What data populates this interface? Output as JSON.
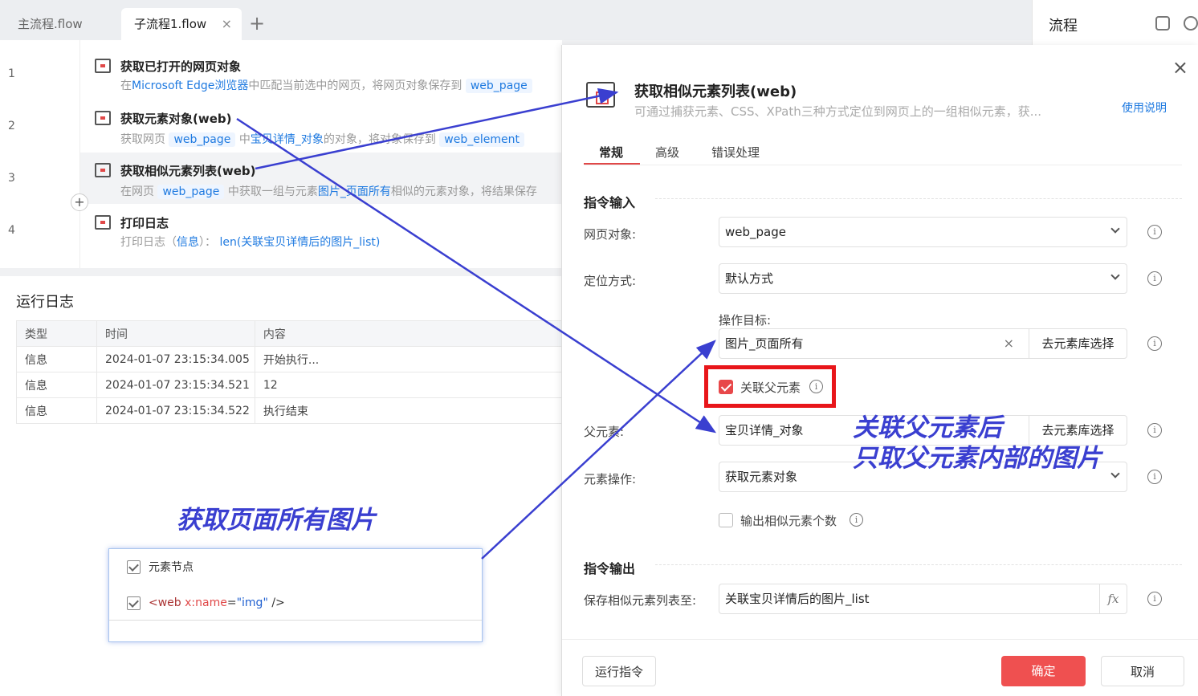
{
  "tabs": {
    "main": "主流程.flow",
    "sub": "子流程1.flow",
    "close": "×",
    "add": "+"
  },
  "flow_panel": {
    "title": "流程"
  },
  "steps": [
    {
      "num": "1",
      "title": "获取已打开的网页对象",
      "desc_a": "在",
      "desc_b": "Microsoft Edge浏览器",
      "desc_c": "中匹配当前选中的网页，将网页对象保存到",
      "desc_tag": "web_page"
    },
    {
      "num": "2",
      "title": "获取元素对象(web)",
      "desc_a": "获取网页",
      "desc_tag": "web_page",
      "desc_b": "中",
      "desc_c": "宝贝详情_对象",
      "desc_d": "的对象，将对象保存到",
      "desc_tag2": "web_element"
    },
    {
      "num": "3",
      "title": "获取相似元素列表(web)",
      "desc_a": "在网页",
      "desc_tag": "web_page",
      "desc_b": "中获取一组与元素",
      "desc_c": "图片_页面所有",
      "desc_d": "相似的元素对象，将结果保存"
    },
    {
      "num": "4",
      "title": "打印日志",
      "desc_a": "打印日志（",
      "desc_b": "信息",
      "desc_c": "）：",
      "desc_d": "len(关联宝贝详情后的图片_list)"
    }
  ],
  "log": {
    "title": "运行日志",
    "columns": [
      "类型",
      "时间",
      "内容"
    ],
    "rows": [
      [
        "信息",
        "2024-01-07 23:15:34.005",
        "开始执行..."
      ],
      [
        "信息",
        "2024-01-07 23:15:34.521",
        "12"
      ],
      [
        "信息",
        "2024-01-07 23:15:34.522",
        "执行结束"
      ]
    ]
  },
  "annotations": {
    "left": "获取页面所有图片",
    "right_line1": "关联父元素后",
    "right_line2": "只取父元素内部的图片"
  },
  "tree_popup": {
    "node_label": "元素节点",
    "xml_open": "<web ",
    "xml_attr": "x:name",
    "xml_eq": "=",
    "xml_val": "\"img\"",
    "xml_close": " />"
  },
  "dialog": {
    "title": "获取相似元素列表(web)",
    "subtitle": "可通过捕获元素、CSS、XPath三种方式定位到网页上的一组相似元素，获...",
    "help": "使用说明",
    "tabs": [
      "常规",
      "高级",
      "错误处理"
    ],
    "section_input": "指令输入",
    "section_output": "指令输出",
    "fields": {
      "page_label": "网页对象:",
      "page_value": "web_page",
      "locate_label": "定位方式:",
      "locate_value": "默认方式",
      "target_label": "操作目标:",
      "target_value": "图片_页面所有",
      "target_btn": "去元素库选择",
      "link_parent": "关联父元素",
      "parent_label": "父元素:",
      "parent_value": "宝贝详情_对象",
      "parent_btn": "去元素库选择",
      "op_label": "元素操作:",
      "op_value": "获取元素对象",
      "count_label": "输出相似元素个数",
      "save_label": "保存相似元素列表至:",
      "save_value": "关联宝贝详情后的图片_list",
      "fx": "fx"
    },
    "buttons": {
      "run": "运行指令",
      "ok": "确定",
      "cancel": "取消"
    }
  },
  "colors": {
    "accent": "#ef5050",
    "link": "#1f7ae0",
    "annotation": "#3a3fd0",
    "highlight_box": "#e8161a"
  }
}
